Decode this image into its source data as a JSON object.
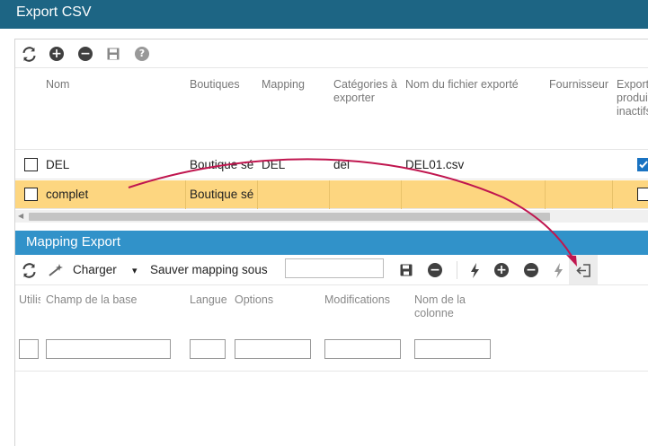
{
  "window": {
    "title": "Export CSV"
  },
  "grid": {
    "toolbar": {
      "refresh_icon": "refresh-icon",
      "add_icon": "plus-circle-icon",
      "remove_icon": "minus-circle-icon",
      "save_icon": "save-icon",
      "help_icon": "help-circle-icon",
      "add_glyph": "+",
      "remove_glyph": "−",
      "help_glyph": "?"
    },
    "columns": [
      "Nom",
      "Boutiques",
      "Mapping",
      "Catégories à exporter",
      "Nom du fichier exporté",
      "Fournisseur",
      "Exporter produits inactifs"
    ],
    "rows": [
      {
        "nom": "DEL",
        "boutiques": "Boutique sé",
        "mapping": "DEL",
        "categories": "del",
        "fichier": "DEL01.csv",
        "fournisseur": "",
        "inactifs": true,
        "selected": false
      },
      {
        "nom": "complet",
        "boutiques": "Boutique sé",
        "mapping": "",
        "categories": "",
        "fichier": "",
        "fournisseur": "",
        "inactifs": false,
        "selected": true
      }
    ],
    "resize_handle": "....."
  },
  "mapping": {
    "title": "Mapping Export",
    "toolbar": {
      "load_label": "Charger",
      "save_as_label": "Sauver mapping sous",
      "save_as_value": "",
      "caret": "▾"
    },
    "columns": [
      "Utilisé",
      "Champ de la base",
      "Langue",
      "Options",
      "Modifications",
      "Nom de la colonne"
    ],
    "filters": [
      "",
      "",
      "",
      "",
      "",
      ""
    ]
  },
  "annotation": {
    "arrow_color": "#c0164f"
  }
}
